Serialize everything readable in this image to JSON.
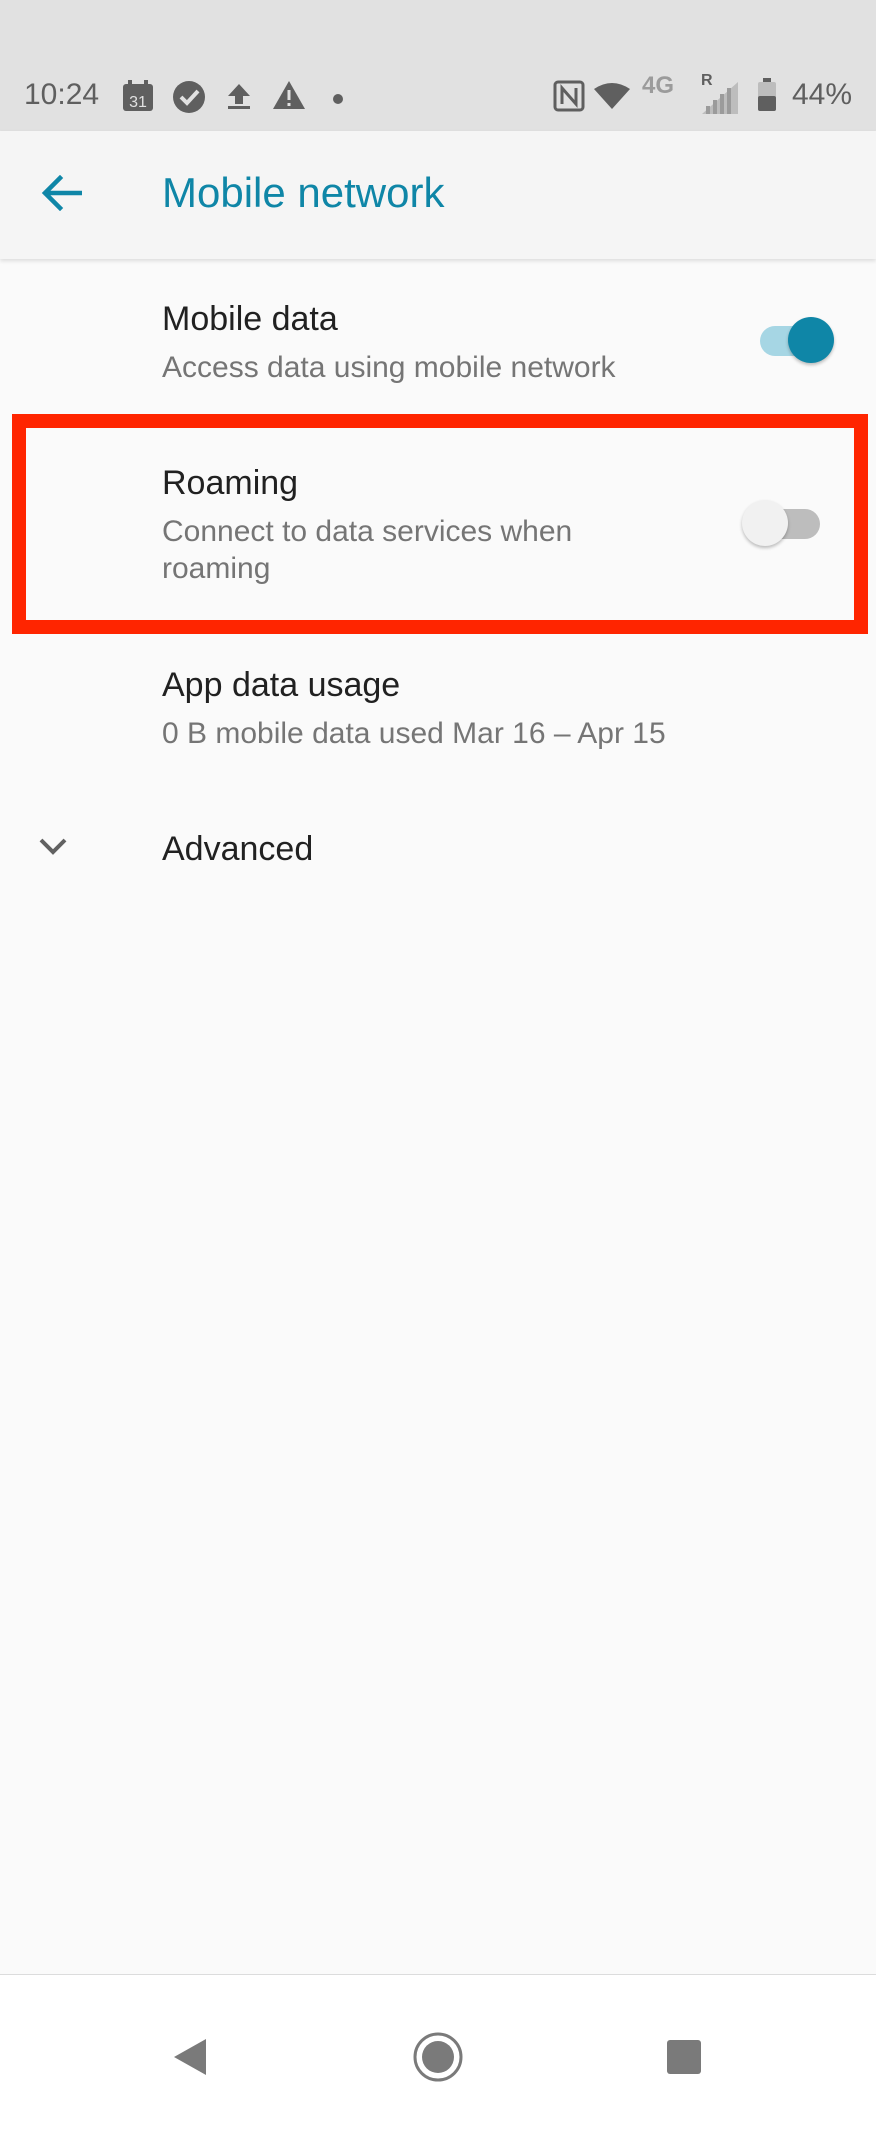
{
  "status_bar": {
    "time": "10:24",
    "calendar_day": "31",
    "network": "4G",
    "roaming_indicator": "R",
    "battery": "44%",
    "icons": [
      "calendar-icon",
      "check-circle-icon",
      "upload-icon",
      "warning-icon",
      "dot-icon",
      "nfc-icon",
      "wifi-icon",
      "signal-icon",
      "battery-icon"
    ]
  },
  "app_bar": {
    "title": "Mobile network",
    "back_icon": "arrow-left-icon",
    "accent_color": "#0f86a7"
  },
  "preferences": {
    "mobile_data": {
      "title": "Mobile data",
      "summary": "Access data using mobile network",
      "enabled": true
    },
    "roaming": {
      "title": "Roaming",
      "summary": "Connect to data services when roaming",
      "enabled": false
    },
    "app_data_usage": {
      "title": "App data usage",
      "summary": "0 B mobile data used Mar 16 – Apr 15"
    },
    "advanced": {
      "title": "Advanced",
      "icon": "chevron-down-icon"
    }
  },
  "highlight_color": "#ff2500",
  "nav_bar": {
    "icons": [
      "back-triangle-icon",
      "home-circle-icon",
      "recents-square-icon"
    ]
  }
}
